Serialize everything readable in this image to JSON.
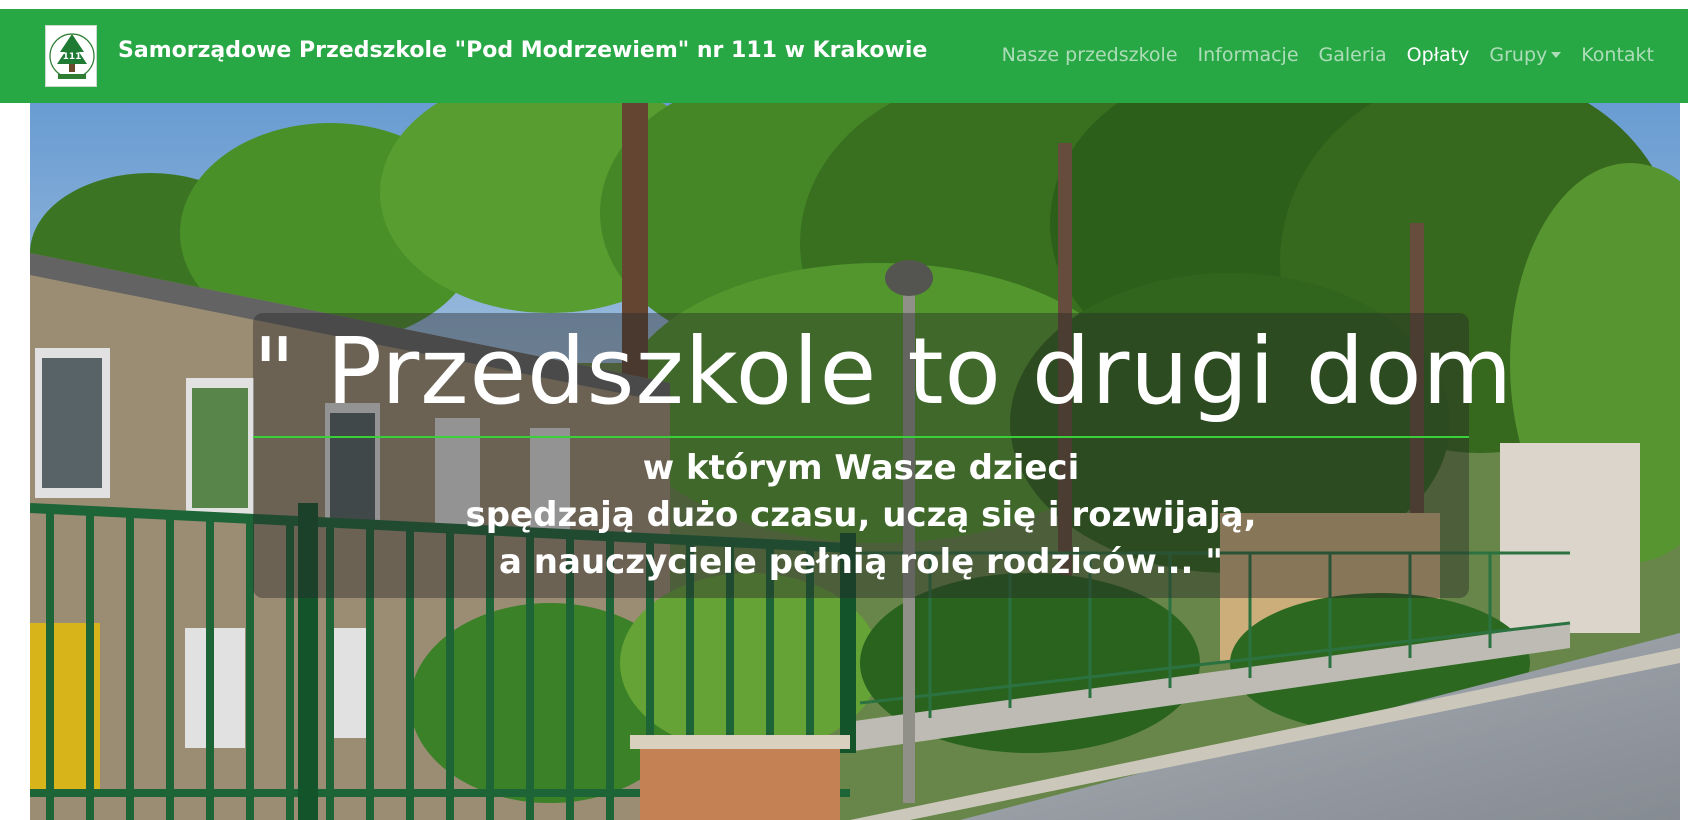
{
  "header": {
    "title": "Samorządowe Przedszkole \"Pod Modrzewiem\" nr 111 w Krakowie",
    "logo_icon": "tree-logo-icon",
    "logo_text": "111",
    "brand_color": "#28a745"
  },
  "nav": {
    "items": [
      {
        "label": "Nasze przedszkole",
        "active": false
      },
      {
        "label": "Informacje",
        "active": false
      },
      {
        "label": "Galeria",
        "active": false
      },
      {
        "label": "Opłaty",
        "active": true
      },
      {
        "label": "Grupy",
        "active": false,
        "dropdown": true
      },
      {
        "label": "Kontakt",
        "active": false
      }
    ]
  },
  "hero": {
    "heading": "\" Przedszkole to drugi dom",
    "lines": [
      "w którym Wasze dzieci",
      "spędzają dużo czasu, uczą się i rozwijają,",
      "a nauczyciele pełnią rolę rodziców... \""
    ],
    "rule_color": "#39d039"
  }
}
